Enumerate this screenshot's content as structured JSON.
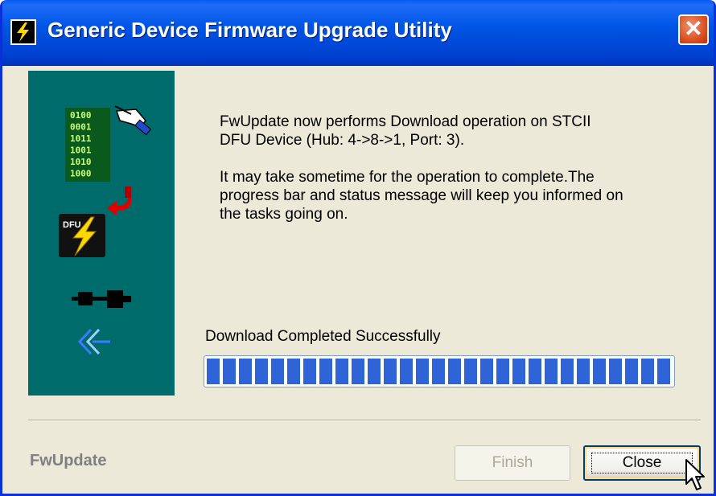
{
  "window": {
    "title": "Generic Device Firmware Upgrade Utility"
  },
  "side_icons": {
    "binary_lines": [
      "0100",
      "0001",
      "1011",
      "1001",
      "1010",
      "1000"
    ],
    "chip_label": "DFU"
  },
  "message": {
    "paragraph1": "FwUpdate now performs Download operation on STCII\nDFU Device (Hub: 4->8->1, Port: 3).",
    "paragraph2": "It may take sometime for the operation to complete.The\nprogress bar and status message will keep you informed on\nthe tasks going on."
  },
  "status": {
    "text": "Download Completed Successfully",
    "progress": 1.0
  },
  "footer": {
    "brand": "FwUpdate"
  },
  "buttons": {
    "finish": "Finish",
    "close": "Close"
  },
  "colors": {
    "title_bar": "#0055e5",
    "side_panel": "#006b6b",
    "progress_fill": "#2f63d8",
    "window_bg": "#ece9d8"
  },
  "icons": [
    "dfu-app-icon",
    "binary-data-icon",
    "hand-pen-icon",
    "red-arrow-icon",
    "dfu-chip-icon",
    "usb-icon",
    "back-arrow-icon",
    "mouse-cursor-icon"
  ]
}
